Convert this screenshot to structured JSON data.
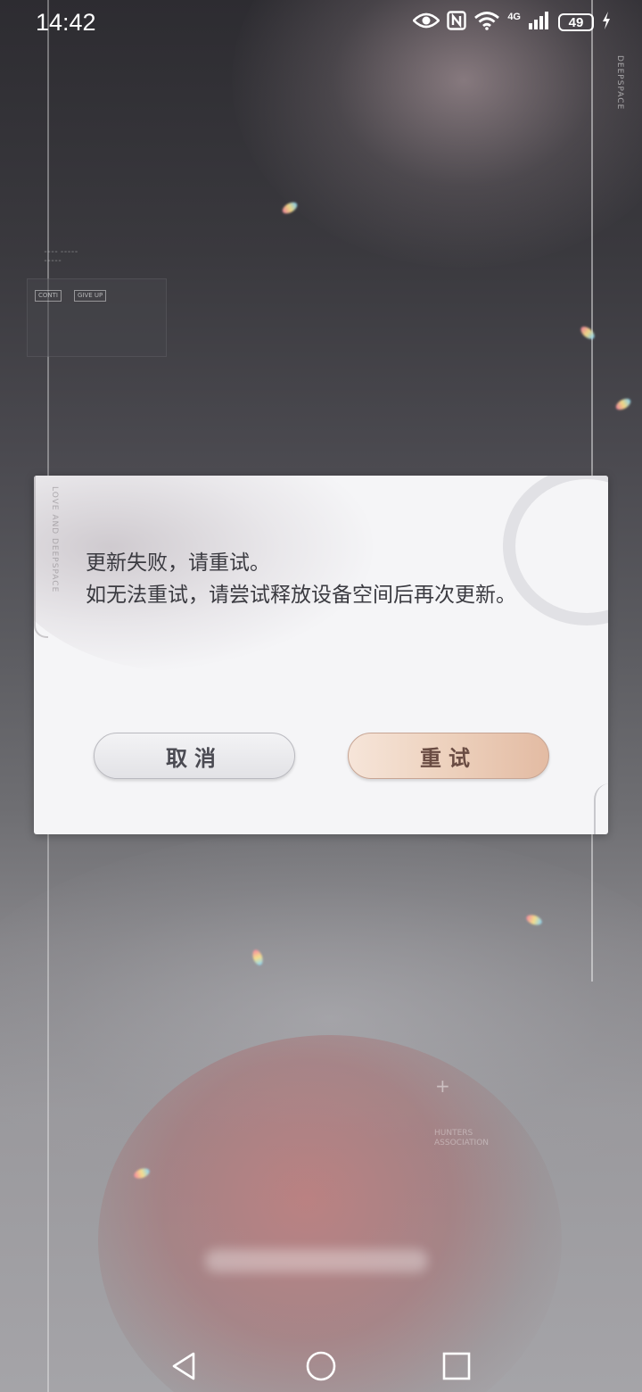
{
  "status_bar": {
    "time": "14:42",
    "network": "4G",
    "battery": "49",
    "icons": [
      "eye-icon",
      "nfc-icon",
      "wifi-icon",
      "signal-icon",
      "battery-icon",
      "charging-icon"
    ]
  },
  "background": {
    "side_brand": "DEEPSPACE",
    "tag_1": "CONTI",
    "tag_2": "GIVE UP",
    "hunters_line_1": "HUNTERS",
    "hunters_line_2": "ASSOCIATION"
  },
  "dialog": {
    "side_text": "LOVE AND DEEPSPACE",
    "message_line_1": "更新失败，请重试。",
    "message_line_2": "如无法重试，请尝试释放设备空间后再次更新。",
    "cancel_label": "取消",
    "retry_label": "重试"
  },
  "nav_bar": {
    "icons": [
      "back-icon",
      "home-icon",
      "recents-icon"
    ]
  },
  "colors": {
    "dialog_bg": "#f5f5f7",
    "message_text": "#3a3a40",
    "retry_button": "#edd1bd",
    "cancel_button": "#e2e2e6"
  }
}
